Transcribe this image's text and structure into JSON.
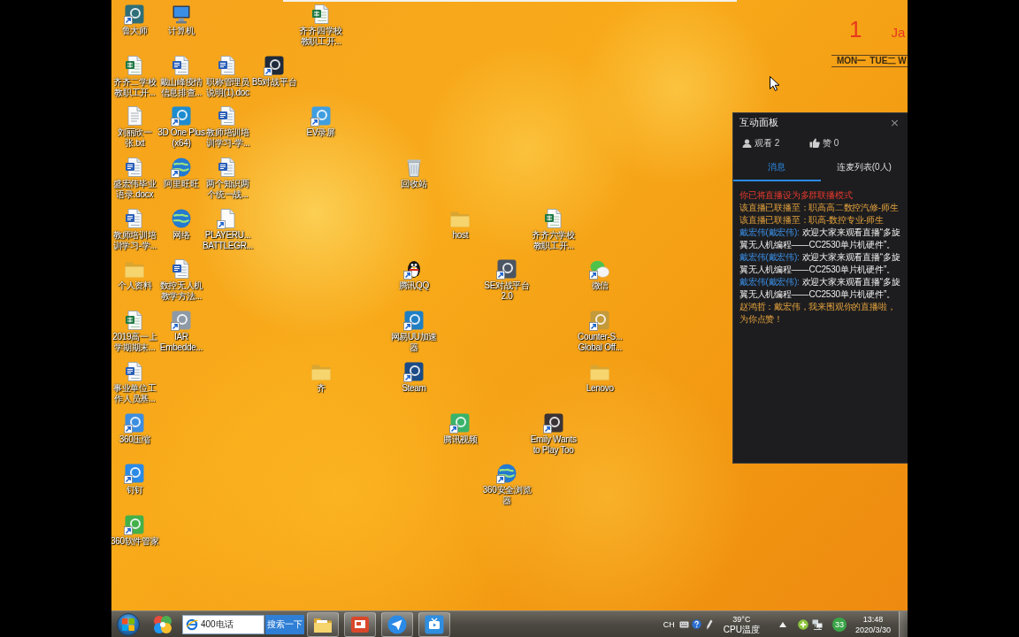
{
  "desktop": {
    "icons": [
      {
        "label": "鲁大师",
        "kind": "app",
        "color": "#2d6e78",
        "shortcut": true
      },
      {
        "label": "计算机",
        "kind": "computer",
        "shortcut": false
      },
      {
        "label": "齐齐四学校教职工开...",
        "kind": "excel",
        "shortcut": false
      },
      {
        "label": "齐齐二学校教职工开...",
        "kind": "excel",
        "shortcut": false
      },
      {
        "label": "戴山峰疫情信息排查...",
        "kind": "word",
        "shortcut": false
      },
      {
        "label": "职称管理员说明(1).doc",
        "kind": "word",
        "shortcut": false
      },
      {
        "label": "B5对战平台",
        "kind": "app",
        "color": "#1f2a3a",
        "shortcut": true
      },
      {
        "label": "刘丽欣一张.txt",
        "kind": "text",
        "shortcut": false
      },
      {
        "label": "3D One Plus (x64)",
        "kind": "app",
        "color": "#1e8ccf",
        "shortcut": true
      },
      {
        "label": "教师培训培训学习-学...",
        "kind": "word",
        "shortcut": false
      },
      {
        "label": "EV录屏",
        "kind": "app",
        "color": "#3f9ee0",
        "shortcut": true
      },
      {
        "label": "盛宏伟毕业语录.docx",
        "kind": "word",
        "shortcut": false
      },
      {
        "label": "阿里旺旺",
        "kind": "globe",
        "shortcut": true
      },
      {
        "label": "两个知识两个统一战...",
        "kind": "word",
        "shortcut": false
      },
      {
        "label": "回收站",
        "kind": "recycle-bin",
        "shortcut": false
      },
      {
        "label": "教师培训培训学习-学...",
        "kind": "word",
        "shortcut": false
      },
      {
        "label": "网络",
        "kind": "globe",
        "shortcut": false
      },
      {
        "label": "PLAYERU... BATTLEGR...",
        "kind": "blank",
        "shortcut": true
      },
      {
        "label": "host",
        "kind": "folder",
        "shortcut": false
      },
      {
        "label": "齐齐六学校教职工开...",
        "kind": "excel",
        "shortcut": false
      },
      {
        "label": "个人资料",
        "kind": "folder",
        "shortcut": false
      },
      {
        "label": "数控无人机教学方法...",
        "kind": "word",
        "shortcut": false
      },
      {
        "label": "腾讯QQ",
        "kind": "penguin",
        "shortcut": true
      },
      {
        "label": "SE对战平台 2.0",
        "kind": "app",
        "color": "#4b5563",
        "shortcut": true
      },
      {
        "label": "微信",
        "kind": "chat",
        "shortcut": true
      },
      {
        "label": "2019高一上学期期末...",
        "kind": "excel",
        "shortcut": false
      },
      {
        "label": "IAR Embedde...",
        "kind": "app",
        "color": "#8d99a6",
        "shortcut": true
      },
      {
        "label": "网易UU加速器",
        "kind": "app",
        "color": "#1f7fc4",
        "shortcut": true
      },
      {
        "label": "Counter-S... Global Off...",
        "kind": "app",
        "color": "#c49a3a",
        "shortcut": true
      },
      {
        "label": "事业单位工作人员基...",
        "kind": "word",
        "shortcut": false
      },
      {
        "label": "齐",
        "kind": "folder",
        "shortcut": false
      },
      {
        "label": "Steam",
        "kind": "app",
        "color": "#1a4b86",
        "shortcut": true
      },
      {
        "label": "Lenovo",
        "kind": "folder",
        "shortcut": false
      },
      {
        "label": "360压缩",
        "kind": "app",
        "color": "#3d8ee0",
        "shortcut": true
      },
      {
        "label": "腾讯视频",
        "kind": "app",
        "color": "#39b36a",
        "shortcut": true
      },
      {
        "label": "Emily Wants to Play Too",
        "kind": "app",
        "color": "#3b3436",
        "shortcut": true
      },
      {
        "label": "钉钉",
        "kind": "app",
        "color": "#2a8ae6",
        "shortcut": true
      },
      {
        "label": "360安全浏览器",
        "kind": "globe",
        "shortcut": true
      },
      {
        "label": "360软件管家",
        "kind": "app",
        "color": "#44b04a",
        "shortcut": true
      }
    ]
  },
  "calendar": {
    "day": "1",
    "month": "Ja",
    "weekdays": [
      "MON一",
      "TUE二",
      "W"
    ]
  },
  "panel": {
    "title": "互动面板",
    "close": "×",
    "stats": [
      {
        "kind": "viewers",
        "text": "观看 2"
      },
      {
        "kind": "likes",
        "text": "赞 0"
      }
    ],
    "tabs": [
      {
        "label": "消息",
        "selected": true
      },
      {
        "label": "连麦列表(0人)",
        "selected": false
      }
    ],
    "messages": [
      {
        "kind": "alert",
        "text": "你已将直播设为多群联播模式"
      },
      {
        "kind": "notice",
        "text": "该直播已联播至：职高高二数控汽修-师生"
      },
      {
        "kind": "notice",
        "text": "该直播已联播至：职高-数控专业-师生"
      },
      {
        "kind": "chat",
        "author": "戴宏伟(戴宏伟):",
        "text": "欢迎大家来观看直播“多旋翼无人机编程——CC2530单片机硬件”。"
      },
      {
        "kind": "chat",
        "author": "戴宏伟(戴宏伟):",
        "text": "欢迎大家来观看直播“多旋翼无人机编程——CC2530单片机硬件”。"
      },
      {
        "kind": "chat",
        "author": "戴宏伟(戴宏伟):",
        "text": "欢迎大家来观看直播“多旋翼无人机编程——CC2530单片机硬件”。"
      },
      {
        "kind": "notice",
        "text": "赵鸿哲：戴宏伟，我来围观你的直播啦，为你点赞！"
      }
    ]
  },
  "taskbar": {
    "search": {
      "value": "400电话",
      "button": "搜索一下"
    },
    "tray": {
      "language": "CH",
      "temperature": "39°C",
      "sensor": "CPU温度",
      "badge": "33",
      "time": "13:48",
      "date": "2020/3/30"
    }
  }
}
